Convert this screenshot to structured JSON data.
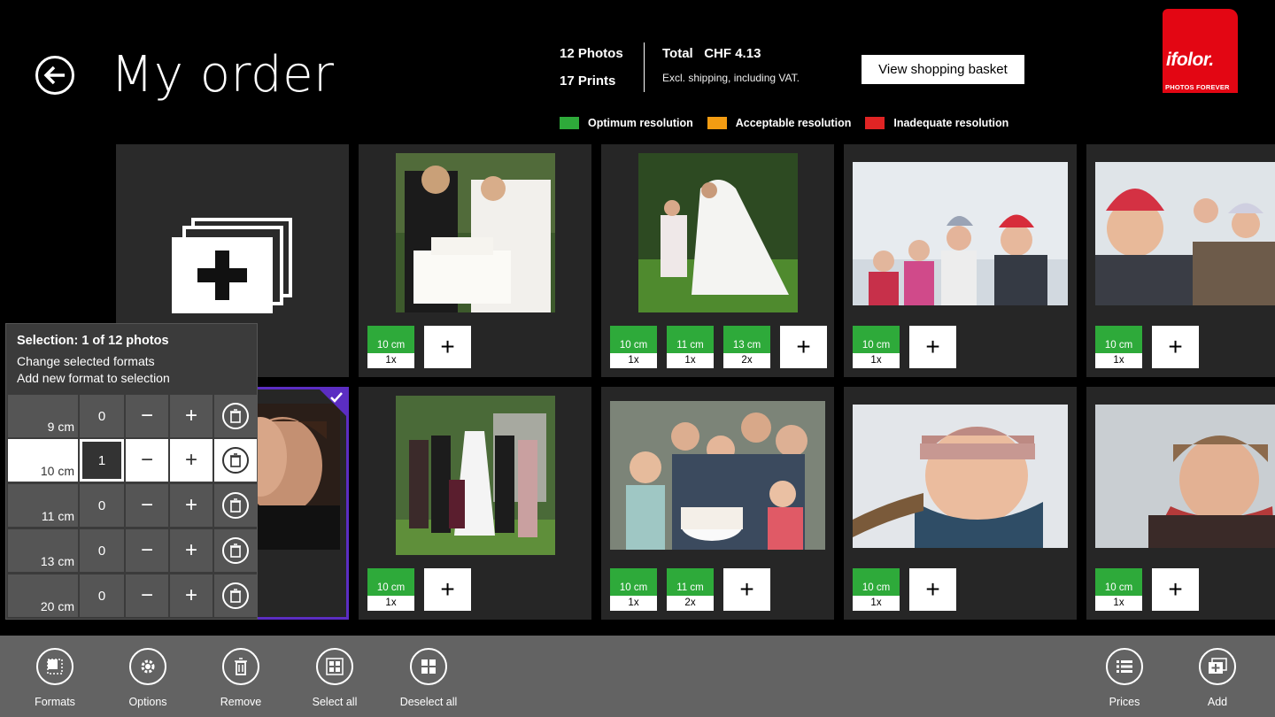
{
  "header": {
    "title": "My order",
    "photos": "12 Photos",
    "prints": "17 Prints",
    "total": "Total   CHF 4.13",
    "total_note": "Excl. shipping, including VAT.",
    "view_basket": "View shopping basket"
  },
  "logo": {
    "text": "ifolor.",
    "tagline": "PHOTOS FOREVER",
    "color": "#e30613"
  },
  "legend": [
    {
      "label": "Optimum resolution",
      "color": "#2eaa3a"
    },
    {
      "label": "Acceptable resolution",
      "color": "#f39c12"
    },
    {
      "label": "Inadequate resolution",
      "color": "#e02424"
    }
  ],
  "tiles": {
    "t1": {
      "formats": [
        {
          "size": "10 cm",
          "qty": "1x"
        }
      ]
    },
    "t2": {
      "formats": [
        {
          "size": "10 cm",
          "qty": "1x"
        },
        {
          "size": "11 cm",
          "qty": "1x"
        },
        {
          "size": "13 cm",
          "qty": "2x"
        }
      ]
    },
    "t3": {
      "formats": [
        {
          "size": "10 cm",
          "qty": "1x"
        }
      ]
    },
    "t4": {
      "formats": [
        {
          "size": "10 cm",
          "qty": "1x"
        }
      ]
    },
    "t6": {
      "formats": [
        {
          "size": "10 cm",
          "qty": "1x"
        }
      ]
    },
    "t7": {
      "formats": [
        {
          "size": "10 cm",
          "qty": "1x"
        },
        {
          "size": "11 cm",
          "qty": "2x"
        }
      ]
    },
    "t8": {
      "formats": [
        {
          "size": "10 cm",
          "qty": "1x"
        }
      ]
    },
    "t9": {
      "formats": [
        {
          "size": "10 cm",
          "qty": "1x"
        }
      ]
    },
    "plus": "+"
  },
  "selection_popup": {
    "title": "Selection: 1 of 12 photos",
    "line1": "Change selected formats",
    "line2": "Add new format to selection",
    "rows": [
      {
        "size": "9 cm",
        "qty": "0"
      },
      {
        "size": "10 cm",
        "qty": "1"
      },
      {
        "size": "11 cm",
        "qty": "0"
      },
      {
        "size": "13 cm",
        "qty": "0"
      },
      {
        "size": "20 cm",
        "qty": "0"
      }
    ],
    "minus": "−",
    "plus": "+"
  },
  "appbar": {
    "formats": "Formats",
    "options": "Options",
    "remove": "Remove",
    "select_all": "Select all",
    "deselect_all": "Deselect all",
    "prices": "Prices",
    "add": "Add"
  }
}
